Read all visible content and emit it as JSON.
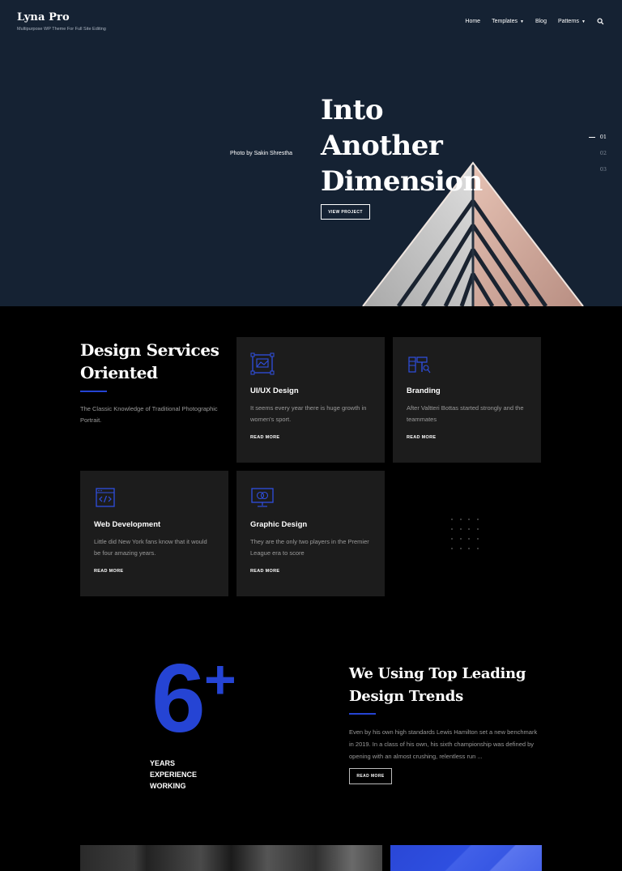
{
  "brand": {
    "title": "Lyna Pro",
    "tagline": "Multipurpose WP Theme For Full Site Editing"
  },
  "nav": {
    "items": [
      {
        "label": "Home",
        "has_dropdown": false
      },
      {
        "label": "Templates",
        "has_dropdown": true
      },
      {
        "label": "Blog",
        "has_dropdown": false
      },
      {
        "label": "Patterns",
        "has_dropdown": true
      }
    ],
    "search_icon": "search-icon"
  },
  "hero": {
    "photo_credit": "Photo by Sakin Shrestha",
    "title_lines": [
      "Into",
      "Another",
      "Dimension"
    ],
    "button_label": "VIEW PROJECT",
    "slides": [
      "01",
      "02",
      "03"
    ],
    "active_slide": "01"
  },
  "services": {
    "heading_lines": [
      "Design Services",
      "Oriented"
    ],
    "subtitle": "The Classic Knowledge of Traditional Photographic Portrait.",
    "cards": [
      {
        "icon": "design-board-icon",
        "title": "UI/UX Design",
        "text": "It seems every year there is huge growth in women's sport.",
        "link": "READ MORE"
      },
      {
        "icon": "branding-tools-icon",
        "title": "Branding",
        "text": "After Valtteri Bottas started strongly and the teammates",
        "link": "READ MORE"
      },
      {
        "icon": "code-window-icon",
        "title": "Web Development",
        "text": "Little did New York fans know that it would be four amazing years.",
        "link": "READ MORE"
      },
      {
        "icon": "monitor-circles-icon",
        "title": "Graphic Design",
        "text": "They are the only two players in the Premier League era to score",
        "link": "READ MORE"
      }
    ]
  },
  "experience": {
    "number": "6",
    "plus": "+",
    "label_lines": [
      "YEARS",
      "EXPERIENCE",
      "WORKING"
    ]
  },
  "trends": {
    "title_lines": [
      "We Using Top Leading",
      "Design Trends"
    ],
    "text": "Even by his own high standards Lewis Hamilton set a new benchmark in 2019. In a class of his own, his sixth championship was defined by opening with an almost crushing, relentless run ...",
    "button_label": "READ MORE"
  },
  "colors": {
    "hero_bg": "#152233",
    "page_bg": "#000000",
    "card_bg": "#1c1c1c",
    "accent": "#2544d4"
  }
}
